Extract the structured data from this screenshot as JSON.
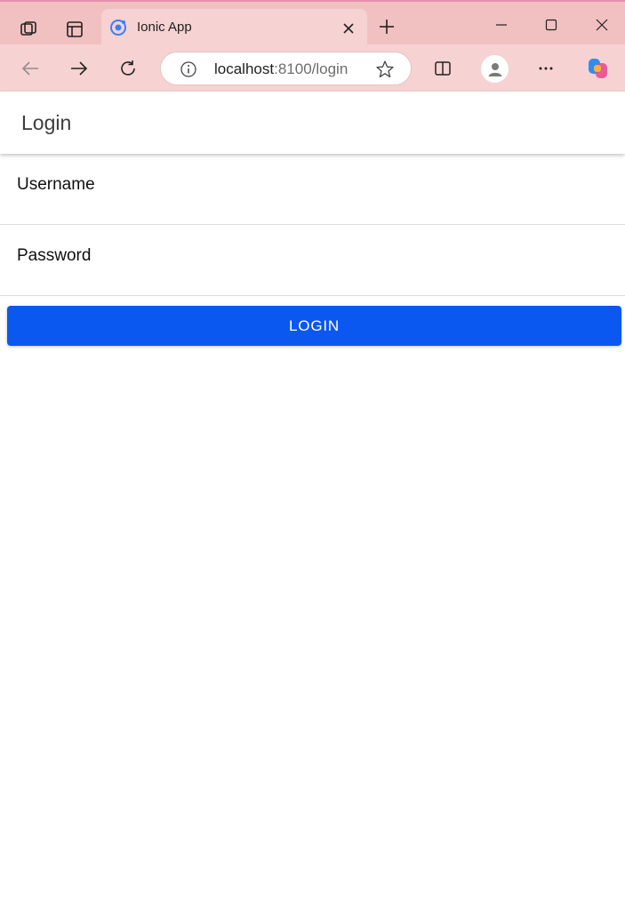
{
  "browser": {
    "tab": {
      "title": "Ionic App"
    },
    "address_bar": {
      "host": "localhost",
      "rest": ":8100/login"
    },
    "icons": {
      "workspaces": "workspaces-icon",
      "vertical_tabs": "vertical-tabs-icon",
      "favicon": "ionic-logo-icon",
      "close_tab": "close-icon",
      "new_tab": "plus-icon",
      "minimize": "minimize-icon",
      "maximize": "maximize-icon",
      "close_window": "close-icon",
      "back": "back-arrow-icon",
      "forward": "forward-arrow-icon",
      "refresh": "refresh-icon",
      "site_info": "info-icon",
      "favorite": "star-icon",
      "split_screen": "split-screen-icon",
      "profile": "profile-icon",
      "more": "more-icon",
      "copilot": "copilot-icon"
    }
  },
  "app": {
    "header": {
      "title": "Login"
    },
    "form": {
      "username": {
        "label": "Username",
        "value": ""
      },
      "password": {
        "label": "Password",
        "value": ""
      },
      "submit_label": "LOGIN"
    },
    "colors": {
      "primary": "#0a58f0",
      "chrome": "#f1c0c0"
    }
  }
}
